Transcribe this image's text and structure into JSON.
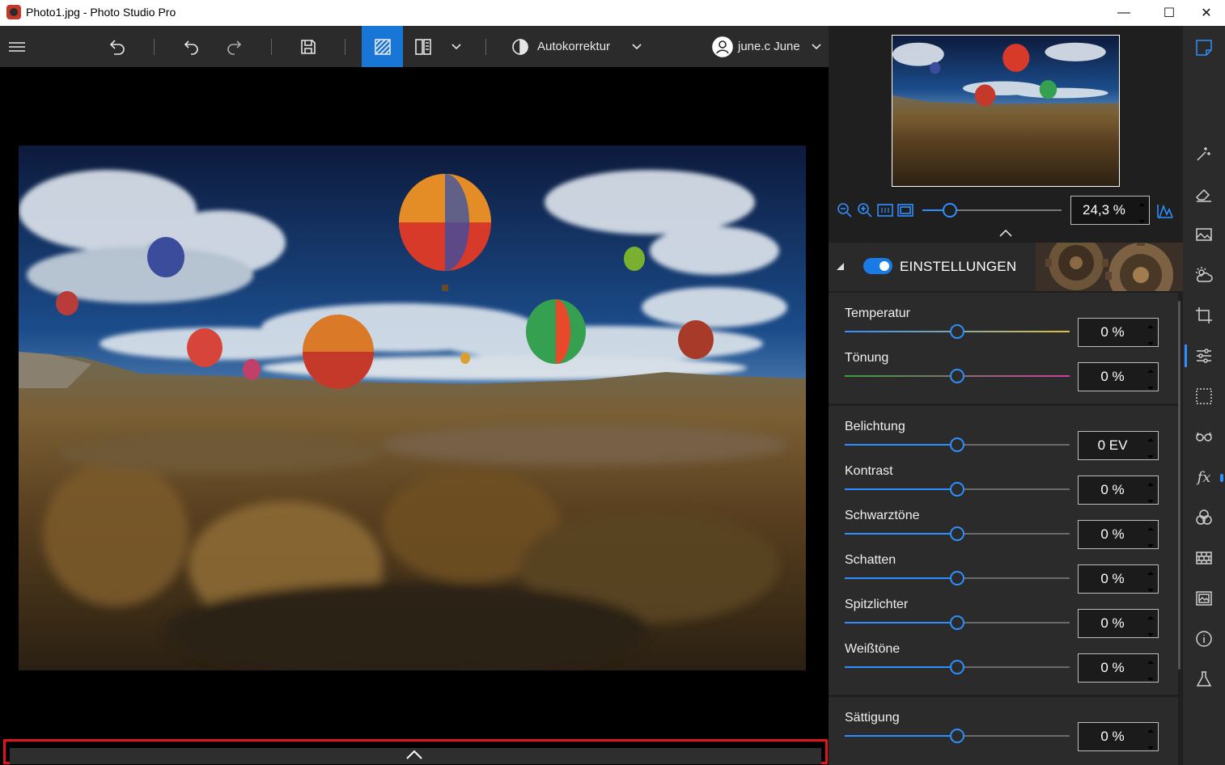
{
  "window": {
    "title": "Photo1.jpg - Photo Studio Pro",
    "minimize": "—",
    "maximize": "☐",
    "close": "✕"
  },
  "toolbar": {
    "autokorrektur_label": "Autokorrektur",
    "user_label": "june.c June"
  },
  "zoom": {
    "value": "24,3 %",
    "slider_level_percent": 20
  },
  "panel": {
    "section_title": "EINSTELLUNGEN",
    "toggle_on": true,
    "groups": [
      {
        "rows": [
          {
            "label": "Temperatur",
            "value": "0 %"
          },
          {
            "label": "Tönung",
            "value": "0 %"
          }
        ]
      },
      {
        "rows": [
          {
            "label": "Belichtung",
            "value": "0 EV"
          },
          {
            "label": "Kontrast",
            "value": "0 %"
          },
          {
            "label": "Schwarztöne",
            "value": "0 %"
          },
          {
            "label": "Schatten",
            "value": "0 %"
          },
          {
            "label": "Spitzlichter",
            "value": "0 %"
          },
          {
            "label": "Weißtöne",
            "value": "0 %"
          }
        ]
      },
      {
        "rows": [
          {
            "label": "Sättigung",
            "value": "0 %"
          }
        ]
      }
    ]
  },
  "colors": {
    "accent": "#2f8fff",
    "highlight_border": "#e0161c"
  }
}
